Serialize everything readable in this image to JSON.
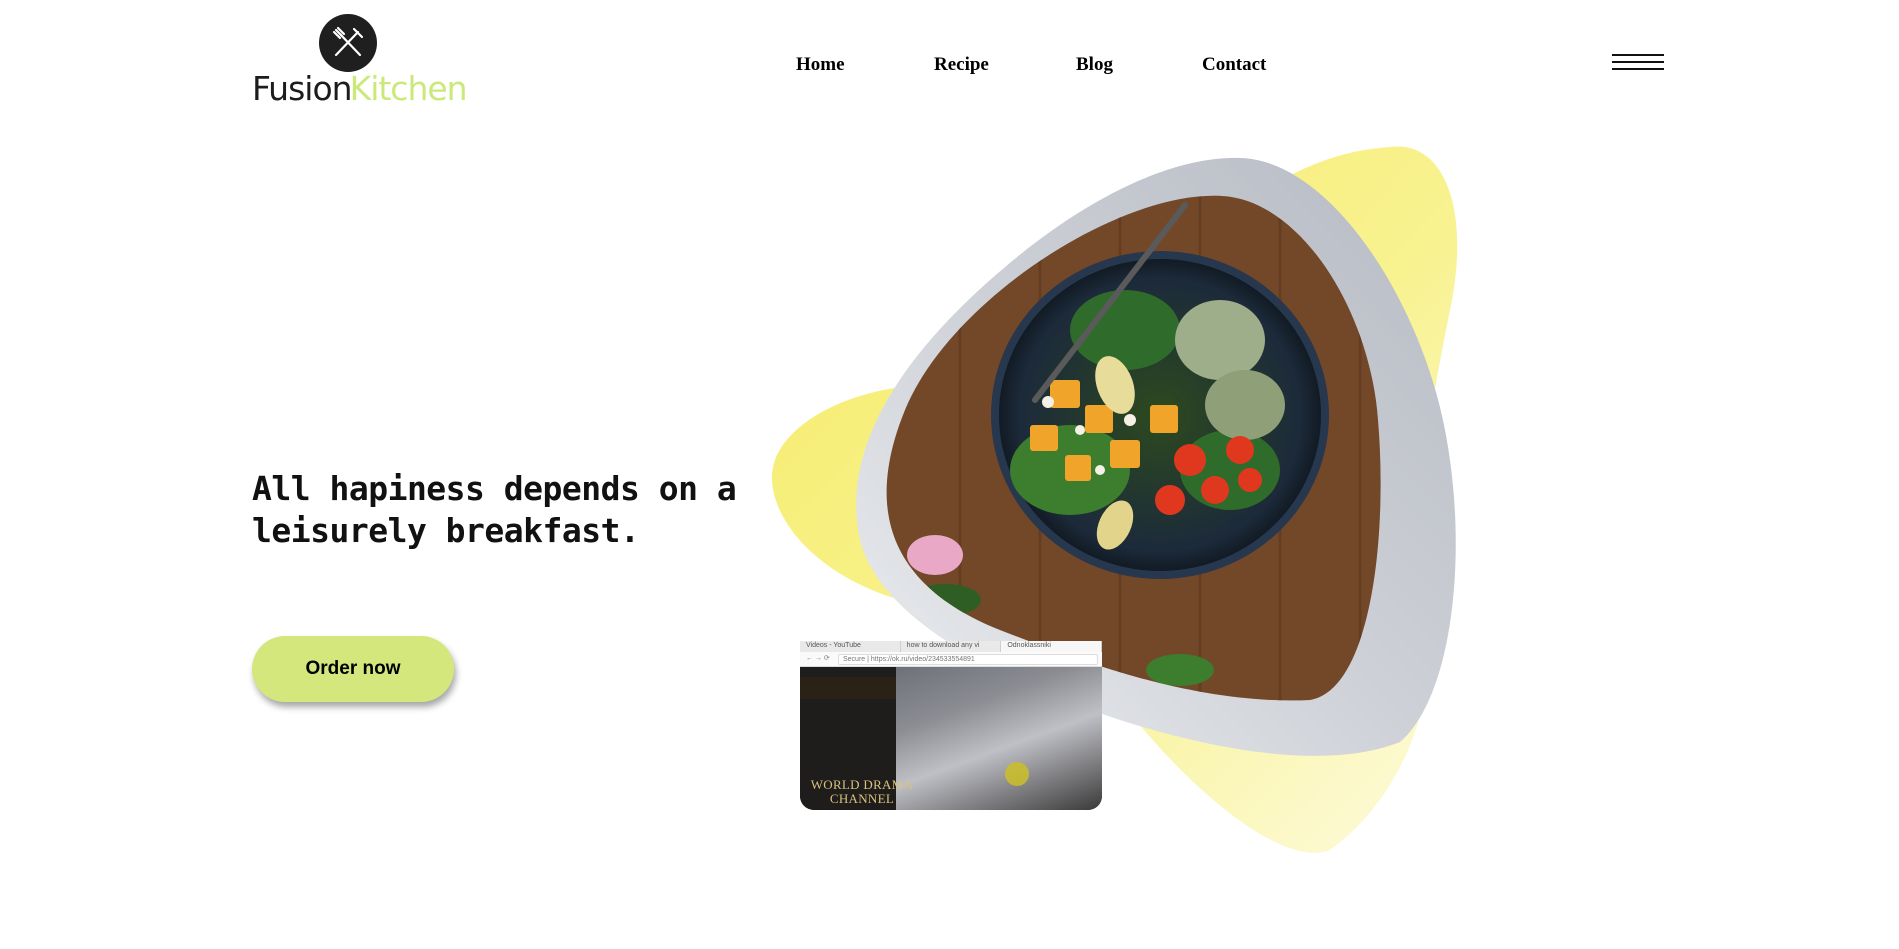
{
  "brand": {
    "name_part1": "Fusion",
    "name_part2": "Kitchen",
    "emblem_icon": "fork-knife-crossed-icon"
  },
  "nav": {
    "items": [
      {
        "label": "Home"
      },
      {
        "label": "Recipe"
      },
      {
        "label": "Blog"
      },
      {
        "label": "Contact"
      }
    ],
    "menu_icon": "hamburger-menu-icon"
  },
  "hero": {
    "headline_line1": "All hapiness depends on a",
    "headline_line2": "leisurely breakfast.",
    "cta_label": "Order now",
    "image": "salad-bowl-photo"
  },
  "video_thumbnail": {
    "tabs": [
      "Videos - YouTube",
      "how to download any vi",
      "Odnoklassniki"
    ],
    "secure_label": "Secure",
    "url": "https://ok.ru/video/234533554891",
    "caption_line1": "WORLD DRAMA",
    "caption_line2": "CHANNEL"
  },
  "colors": {
    "accent_green": "#d3e77d",
    "logo_green": "#cbe97a",
    "yellow_shape": "#f6ef72",
    "gray_frame": "#c0c3ca"
  }
}
